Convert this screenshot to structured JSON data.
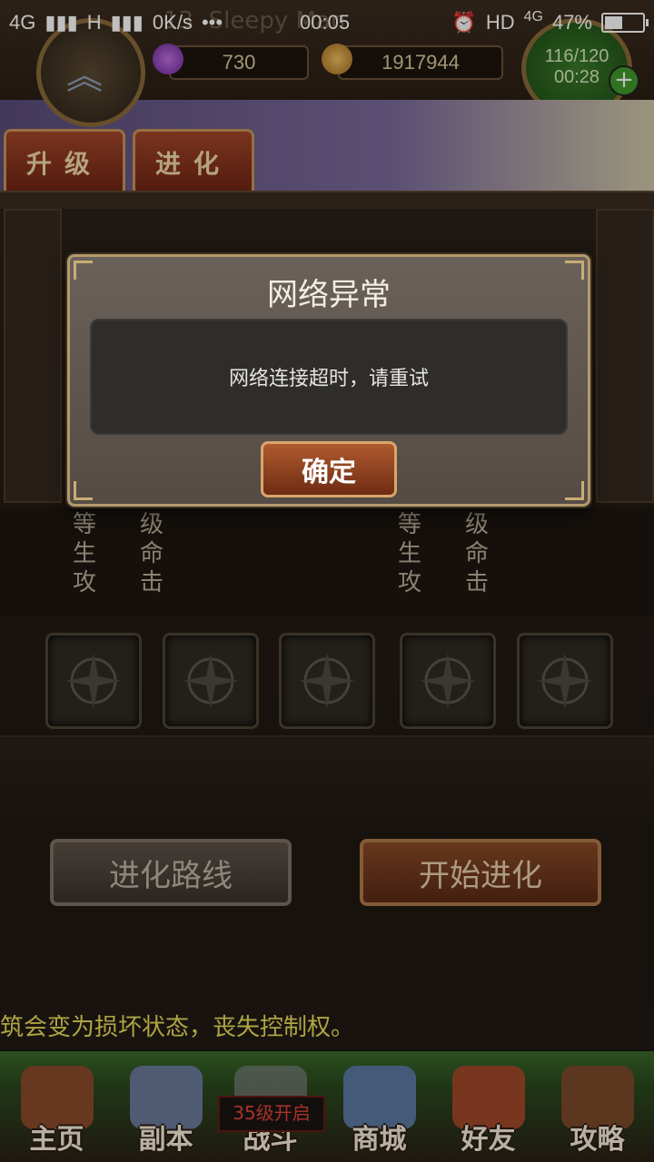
{
  "status_bar": {
    "network_left": "4G",
    "network_mid": "H",
    "speed": "0K/s",
    "more": "•••",
    "time": "00:05",
    "hd": "HD",
    "network_right": "4G",
    "battery": "47%",
    "battery_fill_percent": 47
  },
  "hud": {
    "player_name": "Sleepy Man",
    "level_partial": "13",
    "gems": "730",
    "gold": "1917944",
    "energy": "116/120",
    "energy_timer": "00:28",
    "plus": "+"
  },
  "tabs": {
    "upgrade": "升级",
    "evolve": "进化"
  },
  "stats_left": [
    "等",
    "级",
    "生",
    "命",
    "攻",
    "击"
  ],
  "stats_right": [
    "等",
    "级",
    "生",
    "命",
    "攻",
    "击"
  ],
  "actions": {
    "evolution_route": "进化路线",
    "start_evolution": "开始进化"
  },
  "ticker": "筑会变为损坏状态，丧失控制权。",
  "nav": {
    "items": [
      {
        "label": "主页",
        "icon": "home-icon",
        "color": "#8a4a2a"
      },
      {
        "label": "副本",
        "icon": "dungeon-icon",
        "color": "#6a7a9a"
      },
      {
        "label": "战斗",
        "icon": "battle-icon",
        "color": "#8a8a90"
      },
      {
        "label": "商城",
        "icon": "shop-icon",
        "color": "#5a7aa0"
      },
      {
        "label": "好友",
        "icon": "friends-icon",
        "color": "#a0482a"
      },
      {
        "label": "攻略",
        "icon": "guide-icon",
        "color": "#7a4a2a"
      }
    ],
    "locked_badge": "35级开启"
  },
  "dialog": {
    "title": "网络异常",
    "message": "网络连接超时，请重试",
    "confirm": "确定"
  }
}
